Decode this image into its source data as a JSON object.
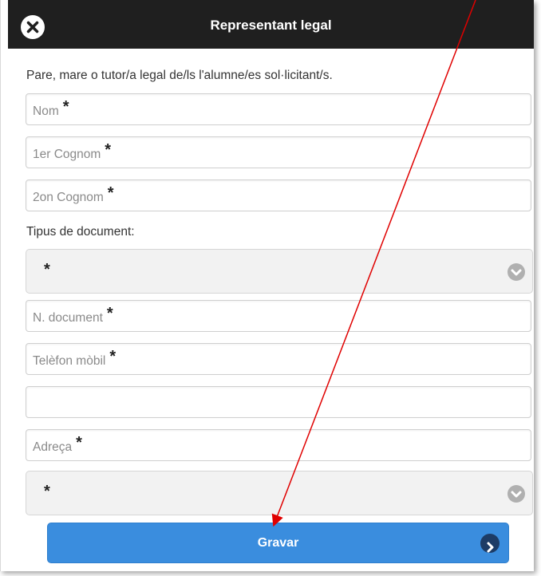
{
  "dialog": {
    "title": "Representant legal",
    "close_icon": "close-icon",
    "intro_text": "Pare, mare o tutor/a legal de/ls l'alumne/es sol·licitant/s."
  },
  "fields": {
    "nom": "Nom",
    "cognom1": "1er Cognom",
    "cognom2": "2on Cognom",
    "tipus_label": "Tipus de document:",
    "ndocument": "N. document",
    "telefon": "Telèfon mòbil",
    "extra": "",
    "adreca": "Adreça",
    "required_mark": "*"
  },
  "selects": {
    "tipus_value": "*",
    "second_value": "*",
    "chevron_icon": "chevron-down-icon"
  },
  "button": {
    "label": "Gravar",
    "icon": "chevron-right-icon",
    "color": "#3a8dde"
  },
  "annotation": {
    "arrow_color": "#e00000"
  }
}
